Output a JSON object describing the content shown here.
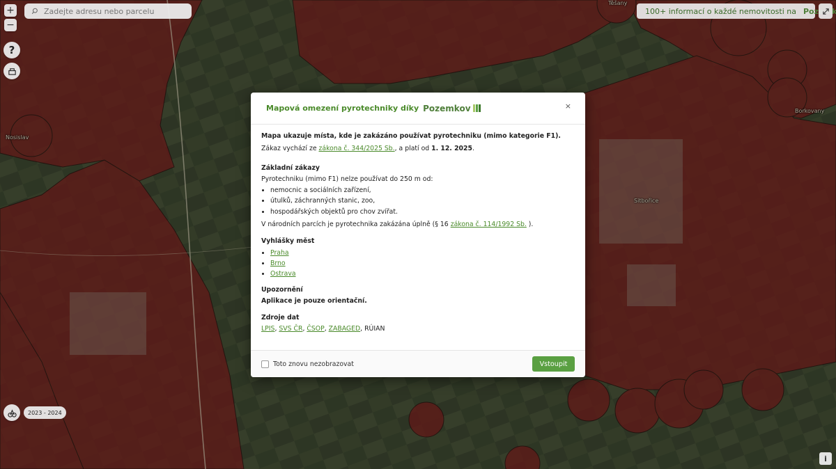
{
  "map": {
    "zoom_in_label": "+",
    "zoom_out_label": "−",
    "help_label": "?",
    "year_range": "2023 - 2024",
    "info_label": "i",
    "places": [
      "Těšany",
      "Borkovany",
      "Nosislav",
      "Sitbořice"
    ]
  },
  "search": {
    "placeholder": "Zadejte adresu nebo parcelu"
  },
  "promo": {
    "text": "100+ informací o každé nemovitosti na",
    "brand": "Pozemkov"
  },
  "modal": {
    "title": "Mapová omezení pyrotechniky díky",
    "brand": "Pozemkov",
    "close_label": "×",
    "lead": "Mapa ukazuje místa, kde je zakázáno používat pyrotechniku (mimo kategorie F1).",
    "law_prefix": "Zákaz vychází ze ",
    "law_link": "zákona č. 344/2025 Sb.",
    "law_mid": ", a platí od ",
    "law_date": "1. 12. 2025",
    "law_end": ".",
    "basic_heading": "Základní zákazy",
    "basic_intro": "Pyrotechniku (mimo F1) nelze používat do 250 m od:",
    "basic_items": [
      "nemocnic a sociálních zařízení,",
      "útulků, záchranných stanic, zoo,",
      "hospodářských objektů pro chov zvířat."
    ],
    "parks_prefix": "V národních parcích je pyrotechnika zakázána úplně (§ 16 ",
    "parks_link": "zákona č. 114/1992 Sb.",
    "parks_end": " ).",
    "cities_heading": "Vyhlášky měst",
    "cities": [
      "Praha",
      "Brno",
      "Ostrava"
    ],
    "warning_heading": "Upozornění",
    "warning_text": "Aplikace je pouze orientační.",
    "sources_heading": "Zdroje dat",
    "sources_links": [
      "LPIS",
      "SVS ČR",
      "ČSOP",
      "ZABAGED"
    ],
    "sources_last": "RÚIAN",
    "checkbox_label": "Toto znovu nezobrazovat",
    "enter_label": "Vstoupit"
  },
  "colors": {
    "accent": "#5aa042",
    "restricted_zone": "#8a1f1f"
  }
}
